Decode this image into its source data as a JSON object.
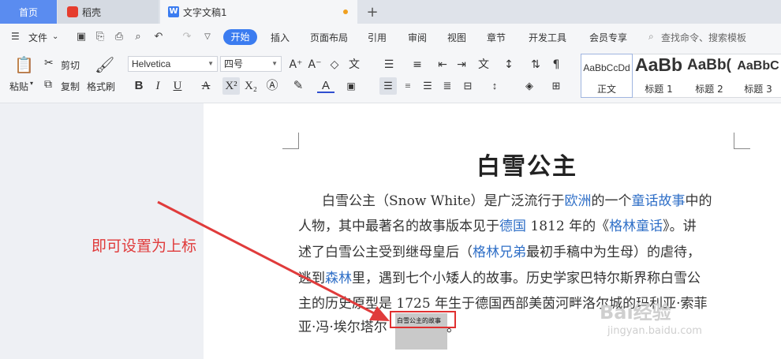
{
  "tabs": {
    "home": "首页",
    "daoke": "稻壳",
    "doc": "文字文稿1"
  },
  "menu": {
    "file": "文件",
    "items": [
      "开始",
      "插入",
      "页面布局",
      "引用",
      "审阅",
      "视图",
      "章节",
      "开发工具",
      "会员专享"
    ],
    "search": "查找命令、搜索模板"
  },
  "toolbar": {
    "paste": "粘贴",
    "cut": "剪切",
    "copy": "复制",
    "format_painter": "格式刷",
    "font_name": "Helvetica",
    "font_size": "四号"
  },
  "styles": [
    {
      "preview": "AaBbCcDd",
      "name": "正文"
    },
    {
      "preview": "AaBb",
      "name": "标题 1"
    },
    {
      "preview": "AaBb(",
      "name": "标题 2"
    },
    {
      "preview": "AaBbC",
      "name": "标题 3"
    }
  ],
  "document": {
    "title": "白雪公主",
    "lines": [
      [
        "白雪公主（Snow White）是广泛流行于",
        "欧洲",
        "的一个",
        "童话故事",
        "中的"
      ],
      [
        "人物，其中最著名的故事版本见于",
        "德国",
        " 1812 年的《",
        "格林童话",
        "》。讲"
      ],
      [
        "述了白雪公主受到继母皇后（",
        "格林兄弟",
        "最初手稿中为生母）的虐待，"
      ],
      [
        "逃到",
        "森林",
        "里，遇到七个小矮人的故事。历史学家巴特尔斯界称白雪公"
      ],
      [
        "主的历史原型是 1725 年生于德国西部美茵河畔洛尔城的玛利亚·索菲"
      ],
      [
        "亚·冯·埃尔塔尔"
      ]
    ],
    "superscript": "白雪公主的故事",
    "tail": "。"
  },
  "annotation": "即可设置为上标",
  "watermark": {
    "main": "Bai经验",
    "sub": "jingyan.baidu.com"
  },
  "colors": {
    "accent": "#3b7cf0",
    "link": "#2f6fc7",
    "annotation": "#e03b3b"
  }
}
